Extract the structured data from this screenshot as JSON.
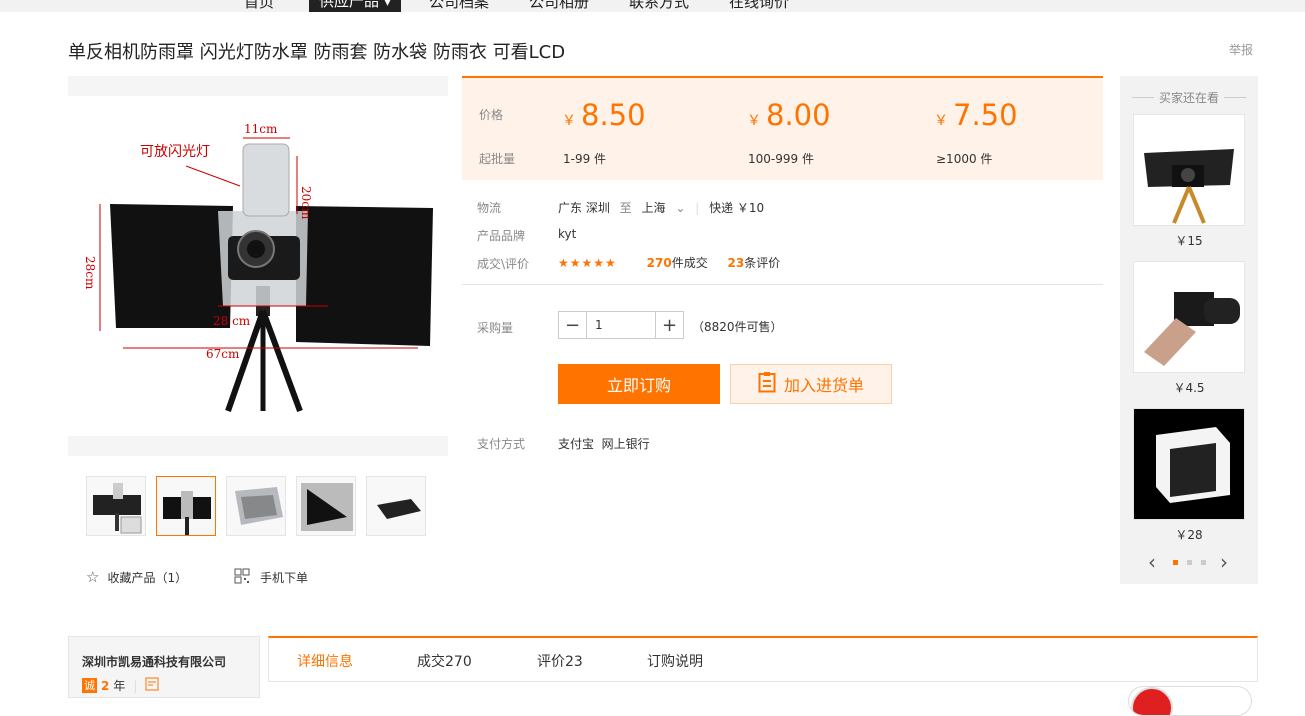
{
  "topnav": {
    "items": [
      "首页",
      "供应产品",
      "公司档案",
      "公司相册",
      "联系方式",
      "在线询价"
    ]
  },
  "product": {
    "title": "单反相机防雨罩 闪光灯防水罩 防雨套 防水袋 防雨衣 可看LCD",
    "report": "举报"
  },
  "gallery": {
    "labels": {
      "flash": "可放闪光灯",
      "w11": "11cm",
      "h20": "20cm",
      "h28": "28cm",
      "w28": "28 cm",
      "w67": "67cm"
    }
  },
  "actions": {
    "favorite": "收藏产品（1）",
    "mobile": "手机下单"
  },
  "pricing": {
    "price_label": "价格",
    "min_label": "起批量",
    "currency": "￥",
    "tiers": [
      {
        "price": "8.50",
        "qty": "1-99 件"
      },
      {
        "price": "8.00",
        "qty": "100-999 件"
      },
      {
        "price": "7.50",
        "qty": "≥1000 件"
      }
    ]
  },
  "logistics": {
    "label": "物流",
    "from": "广东 深圳",
    "to_word": "至",
    "to": "上海",
    "express": "快递 ￥10"
  },
  "brand": {
    "label": "产品品牌",
    "value": "kyt"
  },
  "deal": {
    "label": "成交\\评价",
    "stars": "★★★★★",
    "deals_count": "270",
    "deals_text": "件成交",
    "reviews_count": "23",
    "reviews_text": "条评价"
  },
  "purchase": {
    "label": "采购量",
    "quantity": "1",
    "available": "（8820件可售）",
    "buy_now": "立即订购",
    "add_cart": "加入进货单"
  },
  "payment": {
    "label": "支付方式",
    "methods": "支付宝  网上银行"
  },
  "sidebar": {
    "title": "买家还在看",
    "items": [
      {
        "price": "￥15"
      },
      {
        "price": "￥4.5"
      },
      {
        "price": "￥28"
      }
    ]
  },
  "company": {
    "name": "深圳市凯易通科技有限公司",
    "years": "2",
    "years_unit": "年",
    "badge": "诚"
  },
  "tabs": [
    "详细信息",
    "成交270",
    "评价23",
    "订购说明"
  ],
  "colors": {
    "accent": "#ff7300",
    "price_bg": "#fff2e8"
  }
}
